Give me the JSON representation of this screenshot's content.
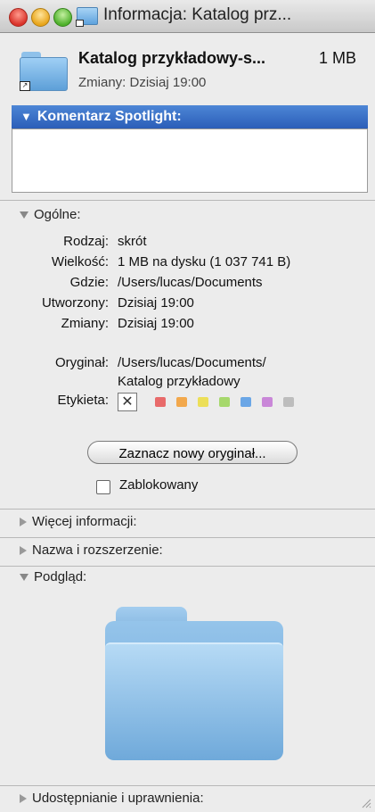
{
  "title": "Informacja: Katalog prz...",
  "header": {
    "name": "Katalog przykładowy-s...",
    "size": "1 MB",
    "modified": "Zmiany:  Dzisiaj 19:00"
  },
  "spotlight": {
    "label": "Komentarz Spotlight:",
    "value": ""
  },
  "general": {
    "label": "Ogólne:",
    "rows": [
      {
        "label": "Rodzaj:",
        "value": "skrót"
      },
      {
        "label": "Wielkość:",
        "value": "1 MB na dysku (1 037 741 B)"
      },
      {
        "label": "Gdzie:",
        "value": "/Users/lucas/Documents"
      },
      {
        "label": "Utworzony:",
        "value": "Dzisiaj 19:00"
      },
      {
        "label": "Zmiany:",
        "value": "Dzisiaj 19:00"
      }
    ],
    "original_label": "Oryginał:",
    "original_line1": "/Users/lucas/Documents/",
    "original_line2": "Katalog przykładowy",
    "tag_label": "Etykieta:",
    "tag_clear": "✕",
    "tag_colors": [
      "#e86a6a",
      "#f2a84c",
      "#ecdf58",
      "#a6d86c",
      "#6aa6e6",
      "#c987d8",
      "#bdbdbd"
    ],
    "select_original": "Zaznacz nowy oryginał...",
    "locked_label": "Zablokowany",
    "locked": false
  },
  "sections": {
    "more_info": "Więcej informacji:",
    "name_ext": "Nazwa i rozszerzenie:",
    "preview": "Podgląd:",
    "sharing": "Udostępnianie i uprawnienia:"
  }
}
